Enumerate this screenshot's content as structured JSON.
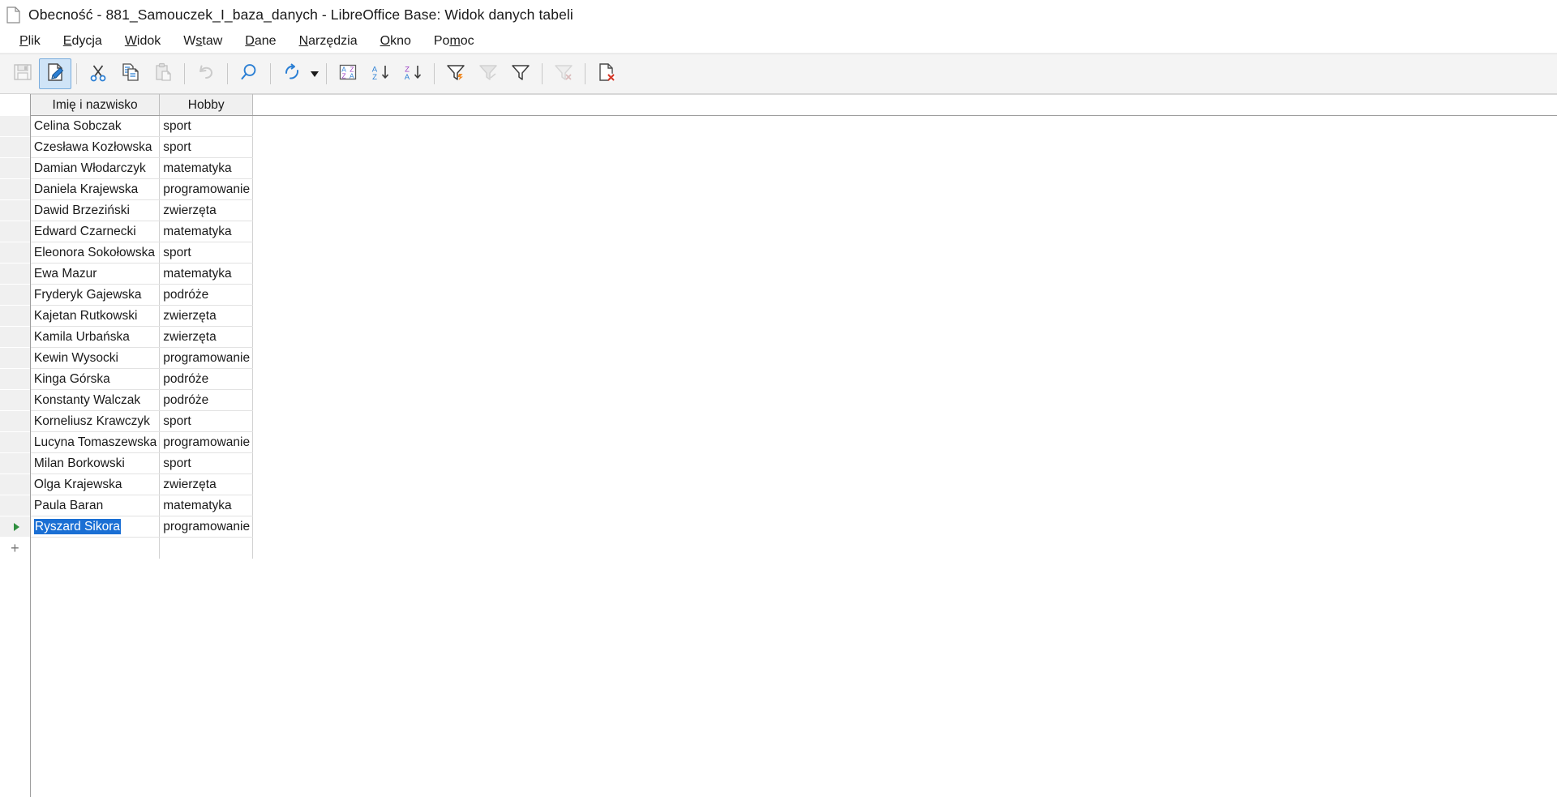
{
  "window": {
    "title": "Obecność - 881_Samouczek_I_baza_danych - LibreOffice Base: Widok danych tabeli",
    "icon": "document-icon"
  },
  "menubar": {
    "items": [
      {
        "label": "Plik",
        "accel": "P"
      },
      {
        "label": "Edycja",
        "accel": "E"
      },
      {
        "label": "Widok",
        "accel": "W"
      },
      {
        "label": "Wstaw",
        "accel": "s"
      },
      {
        "label": "Dane",
        "accel": "D"
      },
      {
        "label": "Narzędzia",
        "accel": "N"
      },
      {
        "label": "Okno",
        "accel": "O"
      },
      {
        "label": "Pomoc",
        "accel": "m"
      }
    ]
  },
  "toolbar": {
    "buttons": [
      {
        "name": "save-button",
        "icon": "save-icon",
        "state": "disabled"
      },
      {
        "name": "edit-data-button",
        "icon": "edit-data-icon",
        "state": "active"
      },
      {
        "name": "cut-button",
        "icon": "scissors-icon",
        "state": "enabled"
      },
      {
        "name": "copy-button",
        "icon": "copy-icon",
        "state": "enabled"
      },
      {
        "name": "paste-button",
        "icon": "clipboard-paste-icon",
        "state": "disabled"
      },
      {
        "name": "undo-button",
        "icon": "undo-arrow-icon",
        "state": "disabled"
      },
      {
        "name": "find-record-button",
        "icon": "magnifier-icon",
        "state": "enabled"
      },
      {
        "name": "refresh-button",
        "icon": "refresh-circle-icon",
        "state": "enabled"
      },
      {
        "name": "sort-dialog-button",
        "icon": "sort-az-za-icon",
        "state": "enabled"
      },
      {
        "name": "sort-ascending-button",
        "icon": "sort-a-z-down-icon",
        "state": "enabled"
      },
      {
        "name": "sort-descending-button",
        "icon": "sort-z-a-down-icon",
        "state": "enabled"
      },
      {
        "name": "autofilter-button",
        "icon": "funnel-lightning-icon",
        "state": "enabled"
      },
      {
        "name": "apply-filter-button",
        "icon": "funnel-gray-icon",
        "state": "disabled"
      },
      {
        "name": "standard-filter-button",
        "icon": "funnel-outline-icon",
        "state": "enabled"
      },
      {
        "name": "remove-filter-button",
        "icon": "funnel-remove-icon",
        "state": "disabled"
      },
      {
        "name": "delete-record-button",
        "icon": "document-delete-icon",
        "state": "enabled"
      }
    ]
  },
  "grid": {
    "columns": [
      {
        "key": "name",
        "label": "Imię i nazwisko"
      },
      {
        "key": "hobby",
        "label": "Hobby"
      }
    ],
    "rows": [
      {
        "name": "Celina Sobczak",
        "hobby": "sport"
      },
      {
        "name": "Czesława Kozłowska",
        "hobby": "sport"
      },
      {
        "name": "Damian Włodarczyk",
        "hobby": "matematyka"
      },
      {
        "name": "Daniela Krajewska",
        "hobby": "programowanie"
      },
      {
        "name": "Dawid Brzeziński",
        "hobby": "zwierzęta"
      },
      {
        "name": "Edward Czarnecki",
        "hobby": "matematyka"
      },
      {
        "name": "Eleonora Sokołowska",
        "hobby": "sport"
      },
      {
        "name": "Ewa Mazur",
        "hobby": "matematyka"
      },
      {
        "name": "Fryderyk Gajewska",
        "hobby": "podróże"
      },
      {
        "name": "Kajetan Rutkowski",
        "hobby": "zwierzęta"
      },
      {
        "name": "Kamila Urbańska",
        "hobby": "zwierzęta"
      },
      {
        "name": "Kewin Wysocki",
        "hobby": "programowanie"
      },
      {
        "name": "Kinga Górska",
        "hobby": "podróże"
      },
      {
        "name": "Konstanty Walczak",
        "hobby": "podróże"
      },
      {
        "name": "Korneliusz Krawczyk",
        "hobby": "sport"
      },
      {
        "name": "Lucyna Tomaszewska",
        "hobby": "programowanie"
      },
      {
        "name": "Milan Borkowski",
        "hobby": "sport"
      },
      {
        "name": "Olga Krajewska",
        "hobby": "zwierzęta"
      },
      {
        "name": "Paula Baran",
        "hobby": "matematyka"
      },
      {
        "name": "Ryszard Sikora",
        "hobby": "programowanie",
        "selected": true,
        "marker": "current-row-triangle"
      }
    ],
    "new_row_marker": "+",
    "selection_color": "#1a6fd4",
    "marker_color": "#2f8f3f"
  }
}
